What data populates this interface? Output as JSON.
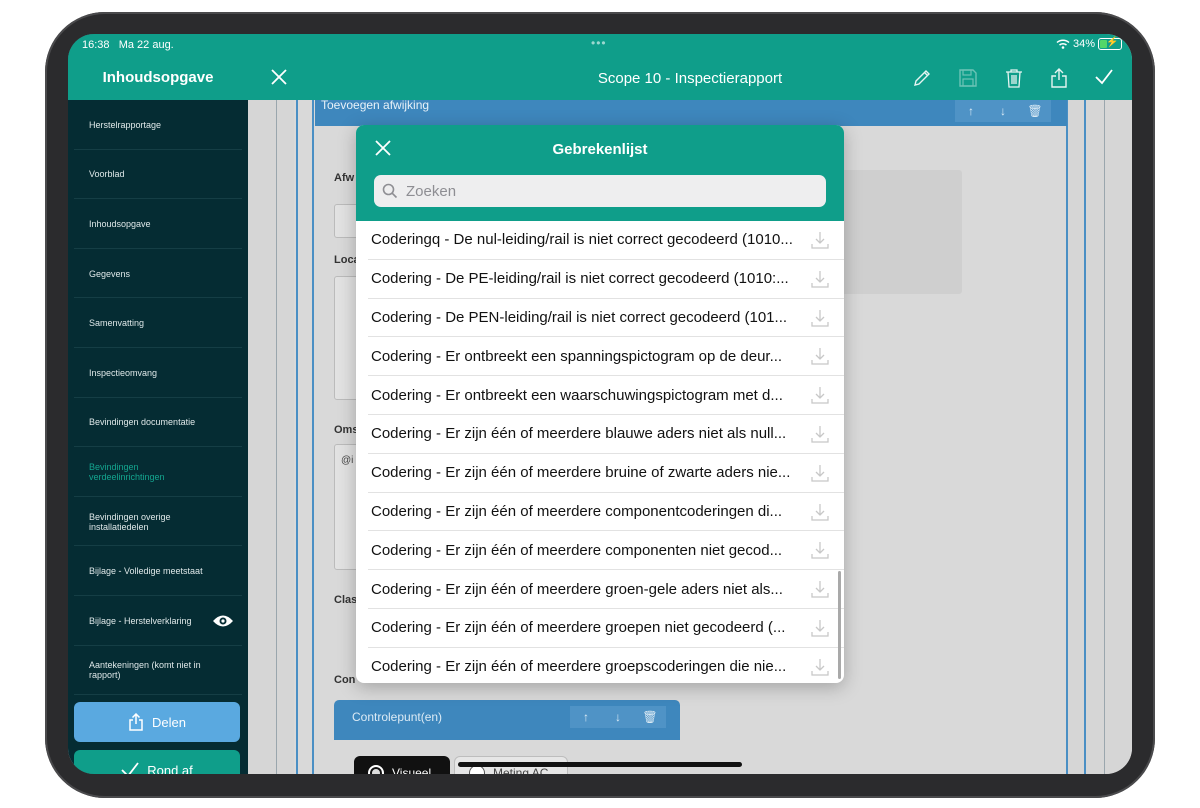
{
  "status": {
    "time": "16:38",
    "date": "Ma 22 aug.",
    "battery": "34%"
  },
  "sidebar": {
    "title": "Inhoudsopgave",
    "items": [
      {
        "label": "Herstelrapportage",
        "active": false
      },
      {
        "label": "Voorblad",
        "active": false
      },
      {
        "label": "Inhoudsopgave",
        "active": false
      },
      {
        "label": "Gegevens",
        "active": false
      },
      {
        "label": "Samenvatting",
        "active": false
      },
      {
        "label": "Inspectieomvang",
        "active": false
      },
      {
        "label": "Bevindingen documentatie",
        "active": false
      },
      {
        "label": "Bevindingen verdeelinrichtingen",
        "active": true
      },
      {
        "label": "Bevindingen overige installatiedelen",
        "active": false
      },
      {
        "label": "Bijlage - Volledige meetstaat",
        "active": false
      },
      {
        "label": "Bijlage - Herstelverklaring",
        "active": false,
        "icon": "eye-icon"
      },
      {
        "label": "Aantekeningen (komt niet in rapport)",
        "active": false
      }
    ],
    "share_label": "Delen",
    "finish_label": "Rond af"
  },
  "header": {
    "title": "Scope 10 - Inspectierapport"
  },
  "background": {
    "bar_title": "Toevoegen afwijking",
    "frag_afw": "Afw",
    "frag_loca": "Loca",
    "frag_oms": "Oms",
    "frag_at": "@i",
    "frag_clas": "Clas",
    "frag_con": "Con",
    "controlepunt_label": "Controlepunt(en)",
    "seg_visual": "Visueel",
    "seg_ac": "Meting AC"
  },
  "modal": {
    "title": "Gebrekenlijst",
    "search_placeholder": "Zoeken",
    "items": [
      "Coderingq - De nul-leiding/rail is niet correct gecodeerd (1010...",
      "Codering - De PE-leiding/rail is niet correct gecodeerd (1010:...",
      "Codering - De PEN-leiding/rail is niet correct gecodeerd (101...",
      "Codering - Er ontbreekt een spanningspictogram op de deur...",
      "Codering - Er ontbreekt een waarschuwingspictogram met d...",
      "Codering - Er zijn één of meerdere blauwe aders niet als null...",
      "Codering - Er zijn één of meerdere bruine of zwarte aders nie...",
      "Codering - Er zijn één of meerdere componentcoderingen di...",
      "Codering - Er zijn één of meerdere componenten niet gecod...",
      "Codering - Er zijn één of meerdere groen-gele aders niet als...",
      "Codering - Er zijn één of meerdere groepen niet gecodeerd  (...",
      "Codering - Er zijn één of meerdere groepscoderingen die nie..."
    ]
  },
  "colors": {
    "teal": "#0f9e8a",
    "sidebar": "#052c33",
    "blue": "#3e87bd",
    "share": "#5aa9e0"
  }
}
